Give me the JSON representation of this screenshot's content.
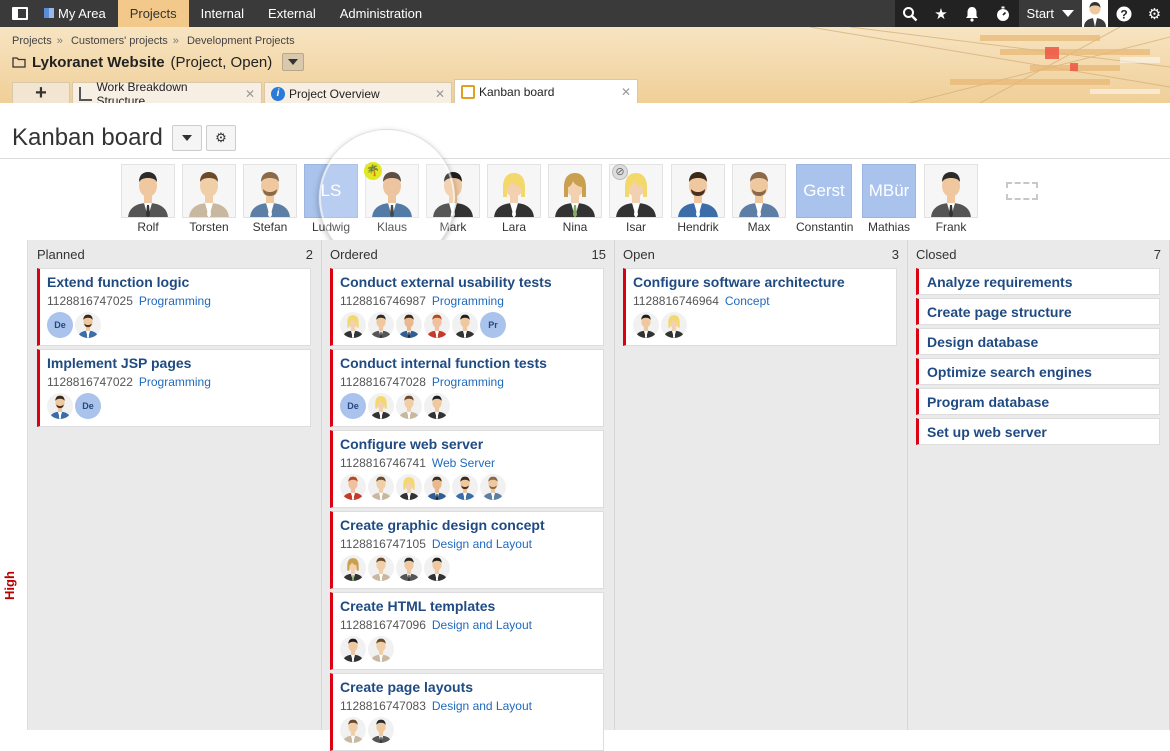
{
  "nav": {
    "items": [
      "My Area",
      "Projects",
      "Internal",
      "External",
      "Administration"
    ],
    "active": "Projects",
    "start_label": "Start"
  },
  "breadcrumb": [
    "Projects",
    "Customers' projects",
    "Development Projects"
  ],
  "project": {
    "name": "Lykoranet Website",
    "suffix": "(Project, Open)"
  },
  "tabs": [
    {
      "label": "Work Breakdown Structure",
      "icon": "wbs-icon"
    },
    {
      "label": "Project Overview",
      "icon": "info-icon"
    },
    {
      "label": "Kanban board",
      "icon": "kanban-icon",
      "active": true
    }
  ],
  "page": {
    "title": "Kanban board"
  },
  "users": [
    {
      "name": "Rolf",
      "initials": ""
    },
    {
      "name": "Torsten",
      "initials": ""
    },
    {
      "name": "Stefan",
      "initials": ""
    },
    {
      "name": "Ludwig",
      "initials": "LS"
    },
    {
      "name": "Klaus",
      "initials": ""
    },
    {
      "name": "Mark",
      "initials": ""
    },
    {
      "name": "Lara",
      "initials": ""
    },
    {
      "name": "Nina",
      "initials": ""
    },
    {
      "name": "Isar",
      "initials": ""
    },
    {
      "name": "Hendrik",
      "initials": ""
    },
    {
      "name": "Max",
      "initials": ""
    },
    {
      "name": "Constantin",
      "initials": "Gerst"
    },
    {
      "name": "Mathias",
      "initials": "MBür"
    },
    {
      "name": "Frank",
      "initials": ""
    }
  ],
  "lane": {
    "label": "High"
  },
  "columns": [
    {
      "name": "Planned",
      "count": "2",
      "cards": [
        {
          "title": "Extend function logic",
          "id": "1128816747025",
          "category": "Programming",
          "avatars": [
            "De",
            "m4"
          ]
        },
        {
          "title": "Implement JSP pages",
          "id": "1128816747022",
          "category": "Programming",
          "avatars": [
            "m4",
            "De"
          ]
        }
      ]
    },
    {
      "name": "Ordered",
      "count": "15",
      "cards": [
        {
          "title": "Conduct external usability tests",
          "id": "1128816746987",
          "category": "Programming",
          "avatars": [
            "f1",
            "m1",
            "m2",
            "m3",
            "m5",
            "Pr"
          ]
        },
        {
          "title": "Conduct internal function tests",
          "id": "1128816747028",
          "category": "Programming",
          "avatars": [
            "De",
            "f1",
            "m6",
            "m5"
          ]
        },
        {
          "title": "Configure web server",
          "id": "1128816746741",
          "category": "Web Server",
          "avatars": [
            "m3",
            "m6",
            "f1",
            "m2",
            "m4",
            "m7"
          ]
        },
        {
          "title": "Create graphic design concept",
          "id": "1128816747105",
          "category": "Design and Layout",
          "avatars": [
            "f2",
            "m6",
            "m1",
            "m5"
          ]
        },
        {
          "title": "Create HTML templates",
          "id": "1128816747096",
          "category": "Design and Layout",
          "avatars": [
            "m5",
            "m6"
          ]
        },
        {
          "title": "Create page layouts",
          "id": "1128816747083",
          "category": "Design and Layout",
          "avatars": [
            "m6",
            "m1"
          ]
        }
      ]
    },
    {
      "name": "Open",
      "count": "3",
      "cards": [
        {
          "title": "Configure software architecture",
          "id": "1128816746964",
          "category": "Concept",
          "avatars": [
            "m5",
            "f1"
          ]
        }
      ]
    },
    {
      "name": "Closed",
      "count": "7",
      "cards": [
        {
          "title": "Analyze requirements"
        },
        {
          "title": "Create page structure"
        },
        {
          "title": "Design database"
        },
        {
          "title": "Optimize search engines"
        },
        {
          "title": "Program database"
        },
        {
          "title": "Set up web server"
        }
      ]
    }
  ],
  "colors": {
    "accent": "#f2c98a",
    "card_border": "#dd0011",
    "title": "#1f4a82",
    "link": "#1f6abf"
  }
}
